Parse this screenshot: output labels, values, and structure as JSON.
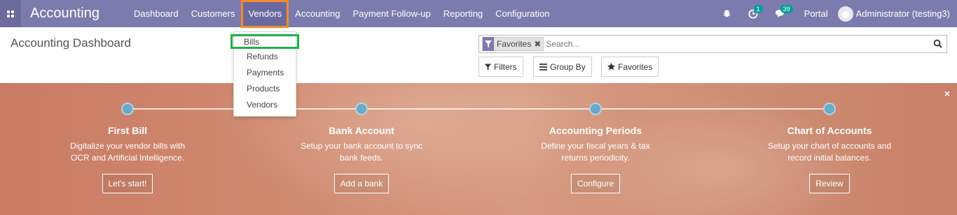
{
  "navbar": {
    "brand": "Accounting",
    "menu": [
      "Dashboard",
      "Customers",
      "Vendors",
      "Accounting",
      "Payment Follow-up",
      "Reporting",
      "Configuration"
    ],
    "activity_count": "1",
    "messages_count": "39",
    "portal_label": "Portal",
    "user_name": "Administrator (testing3)"
  },
  "vendors_menu": {
    "items": [
      "Bills",
      "Refunds",
      "Payments",
      "Products",
      "Vendors"
    ]
  },
  "control_panel": {
    "title": "Accounting Dashboard",
    "facet_label": "Favorites",
    "search_placeholder": "Search...",
    "filters_label": "Filters",
    "groupby_label": "Group By",
    "favorites_label": "Favorites"
  },
  "onboarding": {
    "close": "×",
    "steps": [
      {
        "title": "First Bill",
        "desc1": "Digitalize your vendor bills with",
        "desc2": "OCR and Artificial Intelligence.",
        "button": "Let's start!"
      },
      {
        "title": "Bank Account",
        "desc1": "Setup your bank account to sync",
        "desc2": "bank feeds.",
        "button": "Add a bank"
      },
      {
        "title": "Accounting Periods",
        "desc1": "Define your fiscal years & tax",
        "desc2": "returns periodicity.",
        "button": "Configure"
      },
      {
        "title": "Chart of Accounts",
        "desc1": "Setup your chart of accounts and",
        "desc2": "record initial balances.",
        "button": "Review"
      }
    ]
  },
  "colors": {
    "navbar": "#7c7bad",
    "vendors_highlight": "#f28b28",
    "bills_highlight": "#1db04c",
    "step_dot": "#6aa9c8",
    "badge": "#00a09d"
  }
}
